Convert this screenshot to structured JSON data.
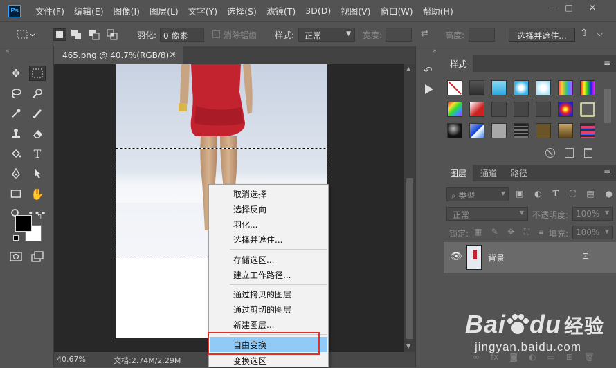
{
  "menubar": {
    "logo": "Ps",
    "items": [
      "文件(F)",
      "编辑(E)",
      "图像(I)",
      "图层(L)",
      "文字(Y)",
      "选择(S)",
      "滤镜(T)",
      "3D(D)",
      "视图(V)",
      "窗口(W)",
      "帮助(H)"
    ],
    "controls": {
      "minimize": "—",
      "restore": "□",
      "close": "✕"
    }
  },
  "options": {
    "feather_label": "羽化:",
    "feather_value": "0 像素",
    "antialias_label": "消除锯齿",
    "style_label": "样式:",
    "style_value": "正常",
    "width_label": "宽度:",
    "height_label": "高度:",
    "select_mask_button": "选择并遮住..."
  },
  "document": {
    "tab_title": "465.png @ 40.7%(RGB/8) *",
    "tab_close": "×",
    "zoom": "40.67%",
    "doc_info": "文档:2.74M/2.29M"
  },
  "context_menu": {
    "items": [
      {
        "label": "取消选择"
      },
      {
        "label": "选择反向"
      },
      {
        "label": "羽化..."
      },
      {
        "label": "选择并遮住..."
      },
      {
        "label": "存储选区..."
      },
      {
        "label": "建立工作路径..."
      },
      {
        "label": "通过拷贝的图层"
      },
      {
        "label": "通过剪切的图层"
      },
      {
        "label": "新建图层..."
      },
      {
        "label": "自由变换"
      },
      {
        "label": "变换选区"
      }
    ],
    "highlighted": "自由变换"
  },
  "styles_panel": {
    "title": "样式",
    "swatch_colors": [
      "#ffffff",
      "#3a3a3a",
      "#5bc7ef",
      "#69c9f0",
      "#bfe9f8",
      "#e8c8e8",
      "#f0e020",
      "#d8d8d8",
      "#c83030",
      "#4a4a4a",
      "#474747",
      "#484848",
      "#c02060",
      "#8a8a8a",
      "#2a2a2a",
      "#4aa0f0",
      "#a0a0a0",
      "#383838",
      "#6a5a30",
      "#7a6a3a",
      "#d04060"
    ]
  },
  "layers_panel": {
    "tabs": [
      "图层",
      "通道",
      "路径"
    ],
    "filter_label": "类型",
    "blend_mode": "正常",
    "opacity_label": "不透明度:",
    "opacity_value": "100%",
    "lock_label": "锁定:",
    "fill_label": "填充:",
    "fill_value": "100%",
    "layer_name": "背景"
  },
  "watermark": {
    "brand": "Bai",
    "brand2": "du",
    "cn": "经验",
    "url": "jingyan.baidu.com"
  }
}
